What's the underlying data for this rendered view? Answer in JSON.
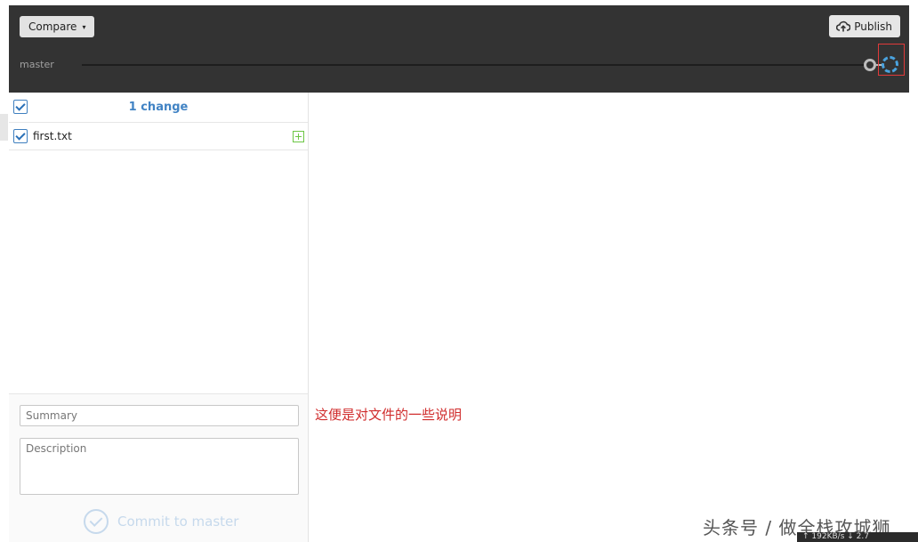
{
  "toolbar": {
    "compare_label": "Compare",
    "compare_caret": "▾",
    "publish_label": "Publish"
  },
  "timeline": {
    "branch": "master"
  },
  "changes": {
    "count_label": "1 change",
    "files": [
      {
        "name": "first.txt",
        "status": "added"
      }
    ]
  },
  "commit": {
    "summary_placeholder": "Summary",
    "description_placeholder": "Description",
    "button_label": "Commit to master"
  },
  "annotation": {
    "text": "这便是对文件的一些说明",
    "color": "#d02c2c"
  },
  "watermark": {
    "text": "头条号 / 做全栈攻城狮"
  },
  "status": {
    "text": "↑ 192KB/s   ↓ 2.7"
  },
  "colors": {
    "accent": "#4183c4",
    "topbar": "#333333",
    "added": "#6cc644",
    "pending_node": "#4aa3df",
    "highlight": "#e03a3a"
  }
}
